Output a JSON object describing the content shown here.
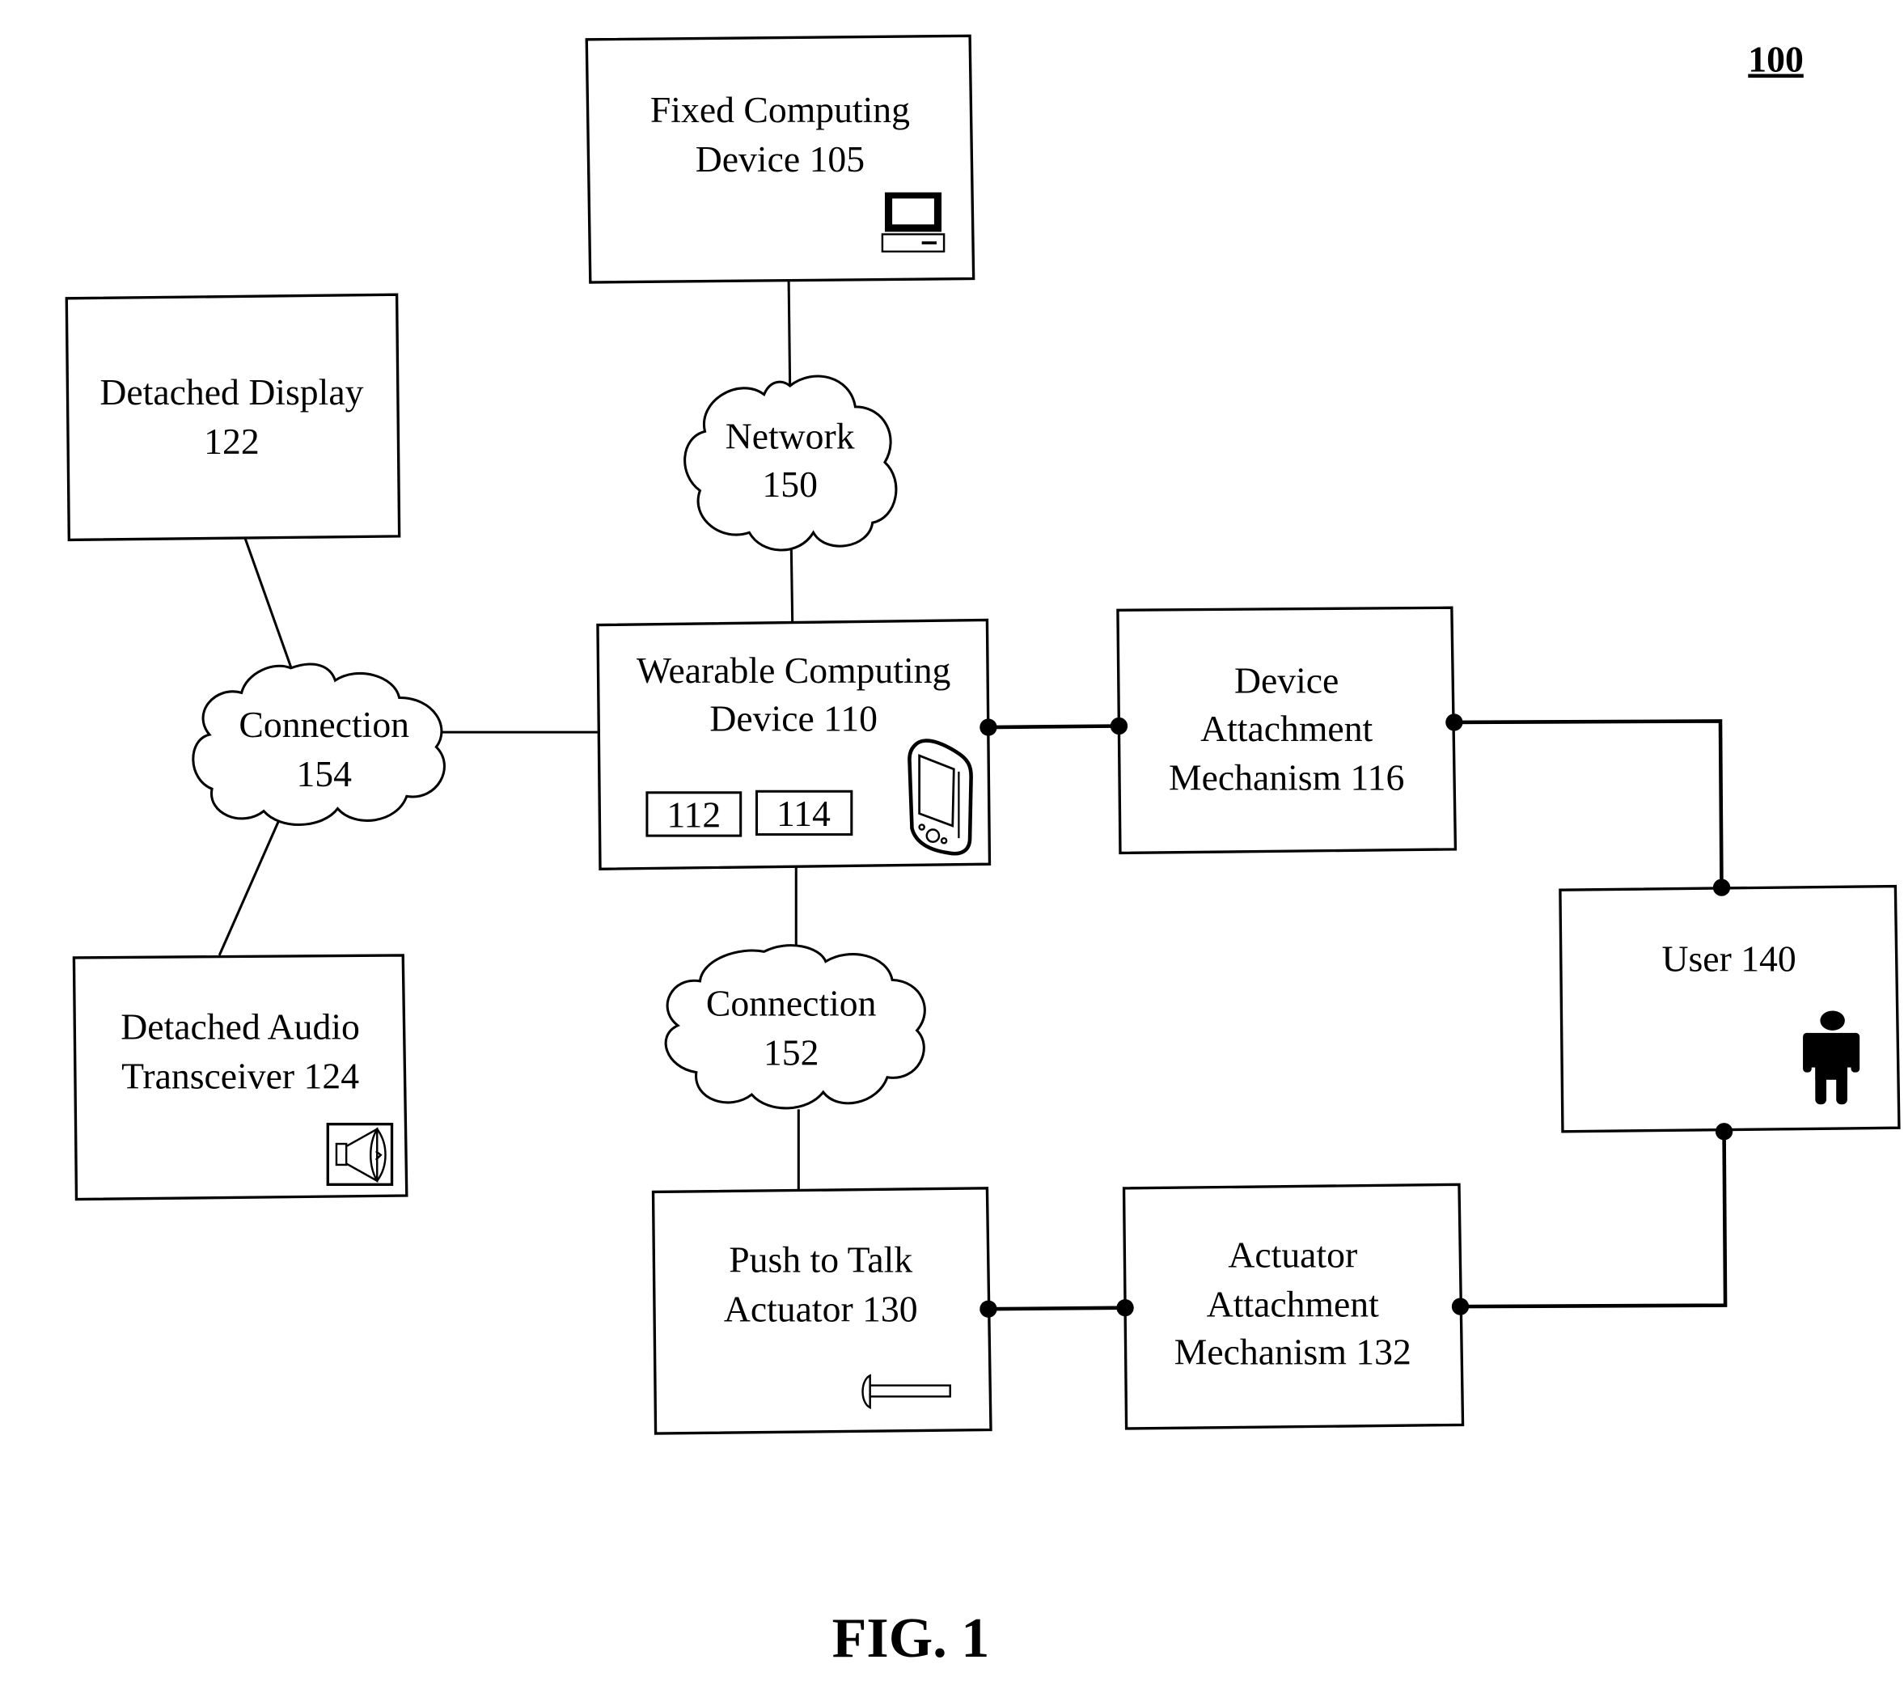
{
  "figure": {
    "reference_number": "100",
    "caption": "FIG. 1"
  },
  "nodes": {
    "fixed_computing_device": {
      "line1": "Fixed Computing",
      "line2": "Device 105",
      "icon": "desktop-computer-icon"
    },
    "network": {
      "line1": "Network",
      "line2": "150",
      "shape": "cloud"
    },
    "detached_display": {
      "line1": "Detached Display",
      "line2": "122"
    },
    "connection_154": {
      "line1": "Connection",
      "line2": "154",
      "shape": "cloud"
    },
    "wearable_computing_device": {
      "line1": "Wearable Computing",
      "line2": "Device 110",
      "sub_a": "112",
      "sub_b": "114",
      "icon": "handheld-device-icon"
    },
    "device_attachment": {
      "line1": "Device",
      "line2": "Attachment",
      "line3": "Mechanism 116"
    },
    "user": {
      "line1": "User 140",
      "icon": "person-icon"
    },
    "detached_audio": {
      "line1": "Detached Audio",
      "line2": "Transceiver 124",
      "icon": "speaker-icon"
    },
    "connection_152": {
      "line1": "Connection",
      "line2": "152",
      "shape": "cloud"
    },
    "push_to_talk": {
      "line1": "Push to Talk",
      "line2": "Actuator 130",
      "icon": "push-button-icon"
    },
    "actuator_attachment": {
      "line1": "Actuator",
      "line2": "Attachment",
      "line3": "Mechanism 132"
    }
  },
  "edges": [
    {
      "from": "Fixed Computing Device 105",
      "to": "Network 150"
    },
    {
      "from": "Network 150",
      "to": "Wearable Computing Device 110"
    },
    {
      "from": "Detached Display 122",
      "to": "Connection 154"
    },
    {
      "from": "Connection 154",
      "to": "Wearable Computing Device 110"
    },
    {
      "from": "Connection 154",
      "to": "Detached Audio Transceiver 124"
    },
    {
      "from": "Wearable Computing Device 110",
      "to": "Connection 152"
    },
    {
      "from": "Connection 152",
      "to": "Push to Talk Actuator 130"
    },
    {
      "from": "Wearable Computing Device 110",
      "to": "Device Attachment Mechanism 116"
    },
    {
      "from": "Device Attachment Mechanism 116",
      "to": "User 140"
    },
    {
      "from": "Push to Talk Actuator 130",
      "to": "Actuator Attachment Mechanism 132"
    },
    {
      "from": "Actuator Attachment Mechanism 132",
      "to": "User 140"
    }
  ]
}
